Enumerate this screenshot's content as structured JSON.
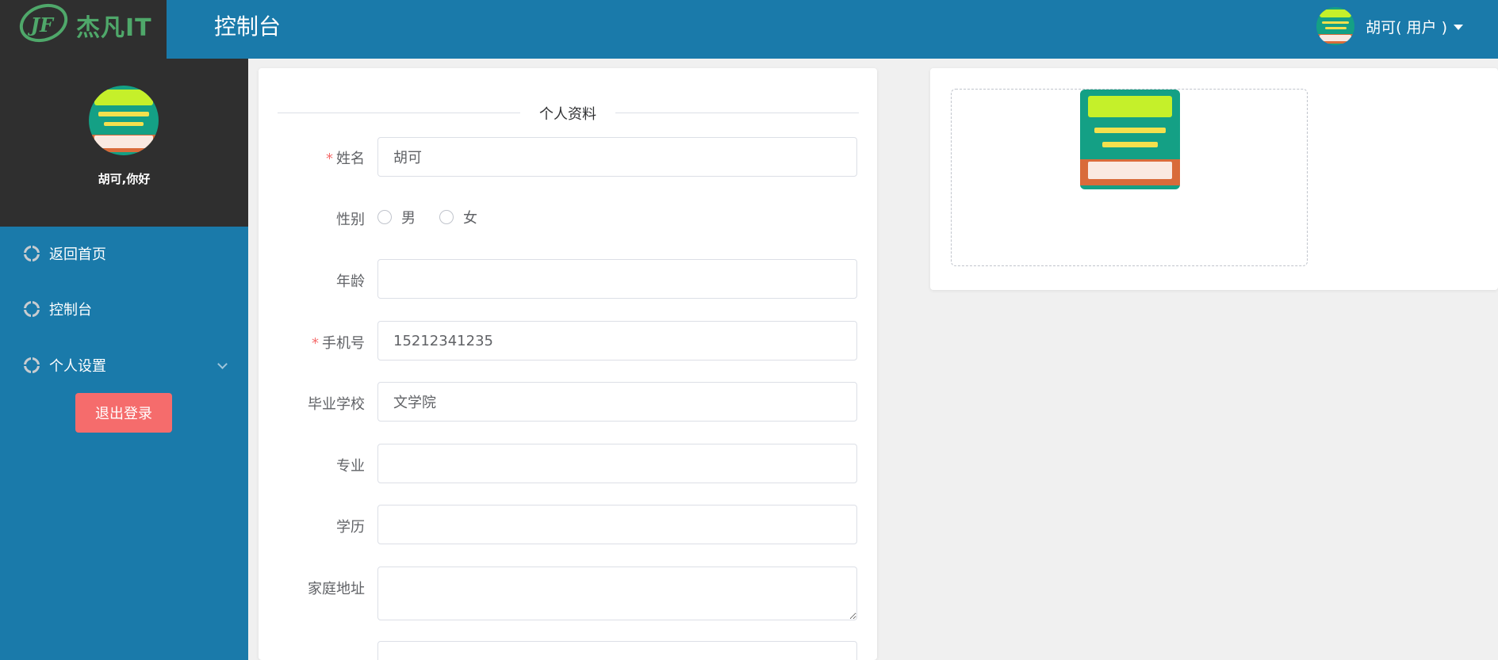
{
  "header": {
    "brand": "杰凡IT",
    "brand_mark": "JF",
    "title": "控制台",
    "user_menu_label": "胡可( 用户 )"
  },
  "sidebar": {
    "greeting": "胡可,你好",
    "items": [
      {
        "label": "返回首页",
        "icon": "nav-circle-icon"
      },
      {
        "label": "控制台",
        "icon": "nav-circle-icon"
      },
      {
        "label": "个人设置",
        "icon": "nav-circle-icon",
        "expandable": true
      }
    ],
    "logout_label": "退出登录"
  },
  "form": {
    "section_title": "个人资料",
    "fields": {
      "name": {
        "label": "姓名",
        "required": "*",
        "value": "胡可"
      },
      "gender": {
        "label": "性别",
        "options": [
          "男",
          "女"
        ]
      },
      "age": {
        "label": "年龄",
        "value": ""
      },
      "phone": {
        "label": "手机号",
        "required": "*",
        "value": "15212341235"
      },
      "school": {
        "label": "毕业学校",
        "value": "文学院"
      },
      "major": {
        "label": "专业",
        "value": ""
      },
      "education": {
        "label": "学历",
        "value": ""
      },
      "address": {
        "label": "家庭地址",
        "value": ""
      }
    }
  },
  "colors": {
    "primary": "#1a7aaa",
    "dark": "#2f2f2f",
    "logout": "#f56c6c",
    "brand_green": "#4fa86a"
  }
}
